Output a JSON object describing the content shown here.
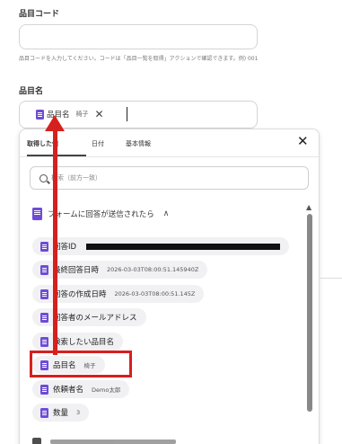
{
  "field_item_code": {
    "label": "品目コード",
    "value": "",
    "help": "品目コードを入力してください。コードは「品目一覧を取得」アクションで確認できます。例) 001"
  },
  "field_item_name": {
    "label": "品目名",
    "chip": {
      "label": "品目名",
      "value": "椅子",
      "remove": "✕"
    }
  },
  "panel": {
    "tabs": [
      {
        "label": "取得した値",
        "active": true
      },
      {
        "label": "日付",
        "active": false
      },
      {
        "label": "基本情報",
        "active": false
      }
    ],
    "close": "✕",
    "search_placeholder": "検索（前方一致）",
    "group": {
      "label": "フォームに回答が送信されたら",
      "chevron": "∧"
    },
    "items": [
      {
        "label": "回答ID",
        "value": "",
        "redacted": true
      },
      {
        "label": "最終回答日時",
        "value": "2026-03-03T08:00:51.145940Z"
      },
      {
        "label": "回答の作成日時",
        "value": "2026-03-03T08:00:51.145Z"
      },
      {
        "label": "回答者のメールアドレス",
        "value": ""
      },
      {
        "label": "検索したい品目名",
        "value": ""
      },
      {
        "label": "品目名",
        "value": "椅子"
      },
      {
        "label": "依頼者名",
        "value": "Demo太郎"
      },
      {
        "label": "数量",
        "value": "3"
      }
    ]
  },
  "annotation": {
    "color": "#d6201e",
    "highlighted_item": "品目名"
  },
  "colors": {
    "doc_icon": "#6e4bd8",
    "chip_bg": "#f1f1f3",
    "scrollbar": "#888888"
  }
}
